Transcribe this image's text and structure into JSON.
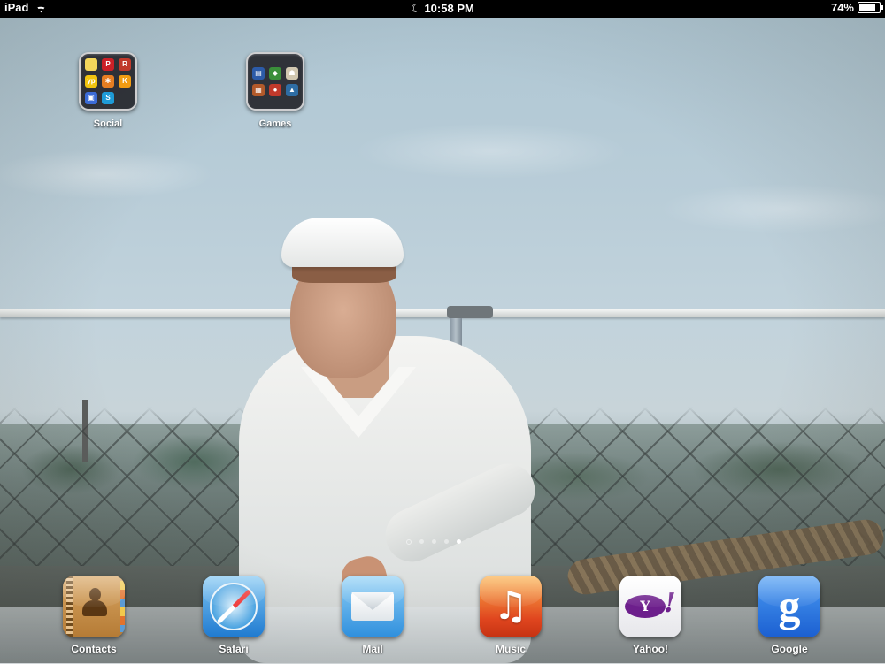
{
  "status_bar": {
    "device": "iPad",
    "time": "10:58 PM",
    "battery_text": "74%",
    "battery_level": 0.74,
    "icons": [
      "wifi-icon",
      "moon-icon",
      "battery-icon"
    ]
  },
  "folders": [
    {
      "label": "Social",
      "apps": [
        {
          "glyph": "",
          "color": "#f3d65b"
        },
        {
          "glyph": "P",
          "color": "#cb2027"
        },
        {
          "glyph": "R",
          "color": "#c0392b"
        },
        {
          "glyph": "yp",
          "color": "#f1c40f"
        },
        {
          "glyph": "✱",
          "color": "#e67e22"
        },
        {
          "glyph": "K",
          "color": "#f39c12"
        },
        {
          "glyph": "▣",
          "color": "#3b6bd6"
        },
        {
          "glyph": "S",
          "color": "#1e9bd7"
        }
      ]
    },
    {
      "label": "Games",
      "apps": [
        {
          "glyph": "▤",
          "color": "#2c5ba8"
        },
        {
          "glyph": "◆",
          "color": "#3a8f3a"
        },
        {
          "glyph": "☗",
          "color": "#d0c7b0"
        },
        {
          "glyph": "▦",
          "color": "#b35a2a"
        },
        {
          "glyph": "●",
          "color": "#c0392b"
        },
        {
          "glyph": "▲",
          "color": "#2e6da4"
        }
      ]
    }
  ],
  "page_dots": {
    "count": 5,
    "active_index": 4
  },
  "dock": [
    {
      "label": "Contacts",
      "icon": "contacts-icon"
    },
    {
      "label": "Safari",
      "icon": "safari-icon"
    },
    {
      "label": "Mail",
      "icon": "mail-icon"
    },
    {
      "label": "Music",
      "icon": "music-icon",
      "glyph": "♫"
    },
    {
      "label": "Yahoo!",
      "icon": "yahoo-icon",
      "logo": "Y",
      "bang": "!"
    },
    {
      "label": "Google",
      "icon": "google-icon",
      "logo": "g"
    }
  ]
}
